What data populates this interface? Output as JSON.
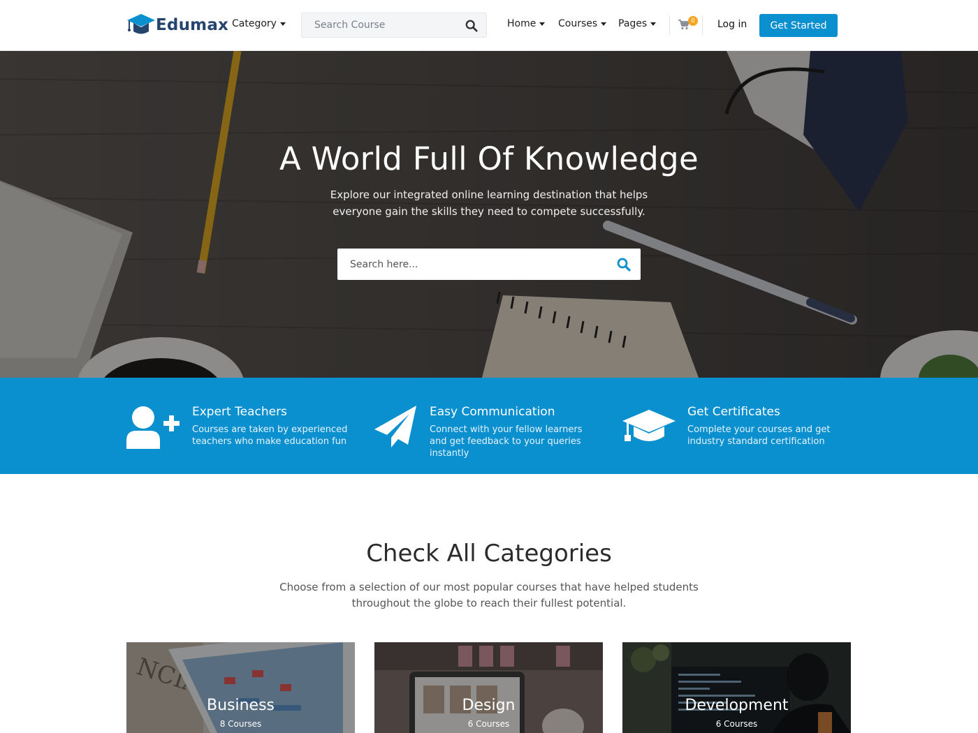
{
  "brand": {
    "name": "Edumax",
    "accent": "#0a8fcf",
    "dark": "#26456e"
  },
  "header": {
    "category_label": "Category",
    "search_placeholder": "Search Course",
    "nav": [
      "Home",
      "Courses",
      "Pages"
    ],
    "cart_count": "0",
    "login_label": "Log in",
    "cta_label": "Get Started"
  },
  "hero": {
    "title": "A World Full Of Knowledge",
    "subtitle": "Explore our integrated online learning destination that helps everyone gain the skills they need to compete successfully.",
    "search_placeholder": "Search here..."
  },
  "features": [
    {
      "icon": "user-plus-icon",
      "title": "Expert Teachers",
      "desc": "Courses are taken by experienced teachers who make education fun"
    },
    {
      "icon": "paper-plane-icon",
      "title": "Easy Communication",
      "desc": "Connect with your fellow learners and get feedback to your queries instantly"
    },
    {
      "icon": "graduation-cap-icon",
      "title": "Get Certificates",
      "desc": "Complete your courses and get industry standard certification"
    }
  ],
  "categories": {
    "title": "Check All Categories",
    "subtitle": "Choose from a selection of our most popular courses that have helped students throughout the globe to reach their fullest potential.",
    "items": [
      {
        "name": "Business",
        "count": "8 Courses"
      },
      {
        "name": "Design",
        "count": "6 Courses"
      },
      {
        "name": "Development",
        "count": "6 Courses"
      }
    ]
  }
}
